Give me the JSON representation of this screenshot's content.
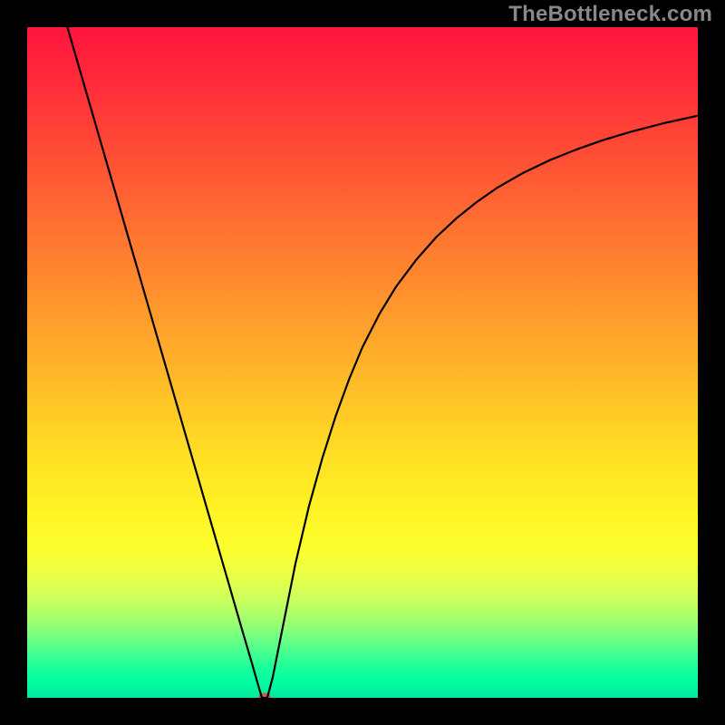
{
  "watermark": "TheBottleneck.com",
  "chart_data": {
    "type": "line",
    "title": "",
    "xlabel": "",
    "ylabel": "",
    "xlim": [
      0,
      100
    ],
    "ylim": [
      0,
      100
    ],
    "grid": false,
    "axes_visible": false,
    "gradient_stops": [
      {
        "pct": 0,
        "color": "#ff153e"
      },
      {
        "pct": 8,
        "color": "#ff2a3a"
      },
      {
        "pct": 16,
        "color": "#ff4436"
      },
      {
        "pct": 24,
        "color": "#ff5e33"
      },
      {
        "pct": 32,
        "color": "#ff7830"
      },
      {
        "pct": 40,
        "color": "#ff922d"
      },
      {
        "pct": 48,
        "color": "#ffab2a"
      },
      {
        "pct": 56,
        "color": "#ffc527"
      },
      {
        "pct": 64,
        "color": "#ffdf24"
      },
      {
        "pct": 72,
        "color": "#fff324"
      },
      {
        "pct": 78,
        "color": "#fdff2f"
      },
      {
        "pct": 82,
        "color": "#e8ff4a"
      },
      {
        "pct": 85.5,
        "color": "#c8ff5d"
      },
      {
        "pct": 88.5,
        "color": "#a0ff70"
      },
      {
        "pct": 91,
        "color": "#70ff82"
      },
      {
        "pct": 93.5,
        "color": "#40ff90"
      },
      {
        "pct": 95.5,
        "color": "#1aff99"
      },
      {
        "pct": 97,
        "color": "#06ffa0"
      },
      {
        "pct": 98.5,
        "color": "#02f7a0"
      },
      {
        "pct": 100,
        "color": "#02e79b"
      }
    ],
    "series": [
      {
        "name": "bottleneck-curve",
        "color": "#000000",
        "points": [
          {
            "x": 6.0,
            "y": 100.0
          },
          {
            "x": 8.0,
            "y": 93.1
          },
          {
            "x": 10.0,
            "y": 86.2
          },
          {
            "x": 12.0,
            "y": 79.3
          },
          {
            "x": 14.0,
            "y": 72.4
          },
          {
            "x": 16.0,
            "y": 65.5
          },
          {
            "x": 18.0,
            "y": 58.6
          },
          {
            "x": 20.0,
            "y": 51.7
          },
          {
            "x": 22.0,
            "y": 44.8
          },
          {
            "x": 24.0,
            "y": 37.9
          },
          {
            "x": 26.0,
            "y": 31.0
          },
          {
            "x": 28.0,
            "y": 24.1
          },
          {
            "x": 30.0,
            "y": 17.2
          },
          {
            "x": 32.0,
            "y": 10.3
          },
          {
            "x": 33.5,
            "y": 5.2
          },
          {
            "x": 34.5,
            "y": 1.7
          },
          {
            "x": 35.0,
            "y": 0.0
          },
          {
            "x": 35.8,
            "y": 0.0
          },
          {
            "x": 36.6,
            "y": 3.0
          },
          {
            "x": 38.0,
            "y": 10.0
          },
          {
            "x": 40.0,
            "y": 20.0
          },
          {
            "x": 42.0,
            "y": 28.5
          },
          {
            "x": 44.0,
            "y": 35.7
          },
          {
            "x": 46.0,
            "y": 42.0
          },
          {
            "x": 48.0,
            "y": 47.5
          },
          {
            "x": 50.0,
            "y": 52.3
          },
          {
            "x": 52.5,
            "y": 57.2
          },
          {
            "x": 55.0,
            "y": 61.3
          },
          {
            "x": 58.0,
            "y": 65.3
          },
          {
            "x": 61.0,
            "y": 68.7
          },
          {
            "x": 64.0,
            "y": 71.5
          },
          {
            "x": 67.0,
            "y": 73.9
          },
          {
            "x": 70.0,
            "y": 76.0
          },
          {
            "x": 74.0,
            "y": 78.3
          },
          {
            "x": 78.0,
            "y": 80.2
          },
          {
            "x": 82.0,
            "y": 81.8
          },
          {
            "x": 86.0,
            "y": 83.2
          },
          {
            "x": 90.0,
            "y": 84.4
          },
          {
            "x": 95.0,
            "y": 85.7
          },
          {
            "x": 100.0,
            "y": 86.8
          }
        ]
      }
    ],
    "minimum_marker": {
      "x": 35.4,
      "y": 0.0,
      "color": "#d15a58"
    }
  }
}
